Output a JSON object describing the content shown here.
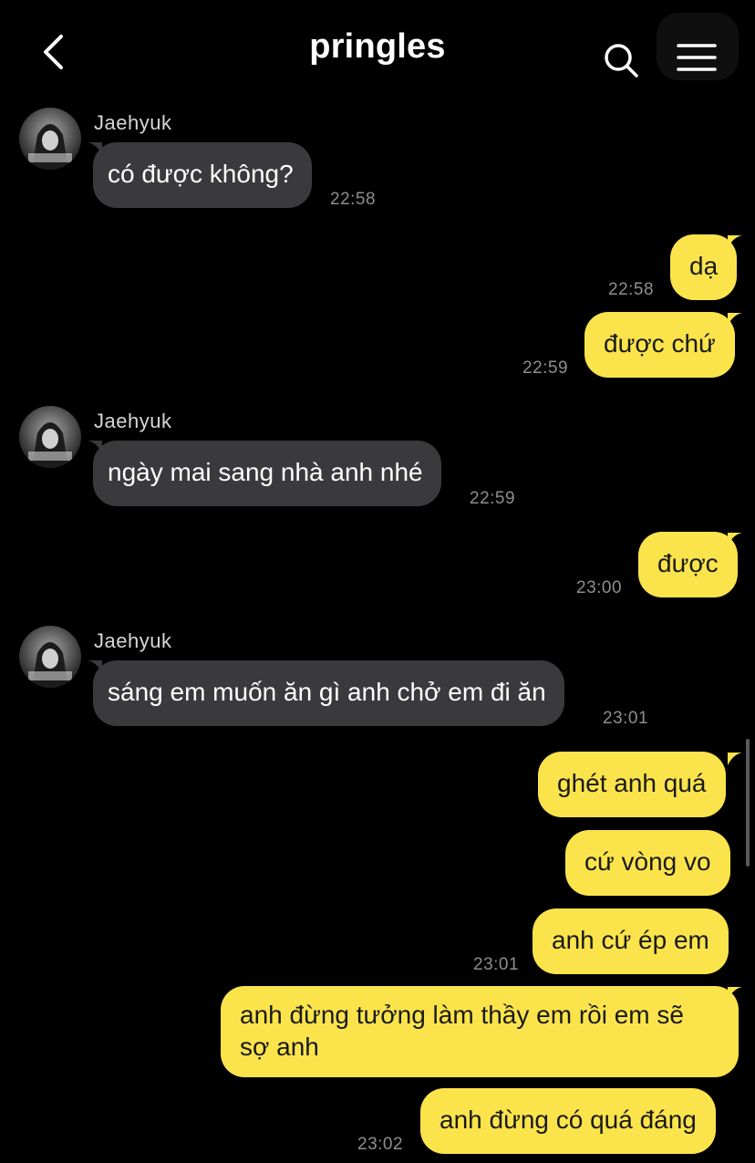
{
  "header": {
    "title": "pringles",
    "back_icon": "chevron-left-icon",
    "search_icon": "search-icon",
    "menu_icon": "hamburger-menu-icon"
  },
  "contact": {
    "name": "Jaehyuk"
  },
  "colors": {
    "incoming_bubble": "#3a3a3c",
    "outgoing_bubble": "#fbe44b",
    "background": "#000000"
  },
  "messages": [
    {
      "dir": "in",
      "sender": "Jaehyuk",
      "text": "có được không?",
      "time": "22:58"
    },
    {
      "dir": "out",
      "text": "dạ",
      "time": "22:58"
    },
    {
      "dir": "out",
      "text": "được chứ",
      "time": "22:59"
    },
    {
      "dir": "in",
      "sender": "Jaehyuk",
      "text": "ngày mai sang nhà anh nhé",
      "time": "22:59"
    },
    {
      "dir": "out",
      "text": "được",
      "time": "23:00"
    },
    {
      "dir": "in",
      "sender": "Jaehyuk",
      "text": "sáng em muốn ăn gì anh chở em đi ăn",
      "time": "23:01"
    },
    {
      "dir": "out",
      "text": "ghét anh quá"
    },
    {
      "dir": "out",
      "text": "cứ vòng vo"
    },
    {
      "dir": "out",
      "text": "anh cứ ép em",
      "time": "23:01"
    },
    {
      "dir": "out",
      "text": "anh đừng tưởng làm thầy em rồi em sẽ sợ anh"
    },
    {
      "dir": "out",
      "text": "anh đừng có quá đáng",
      "time": "23:02"
    }
  ]
}
